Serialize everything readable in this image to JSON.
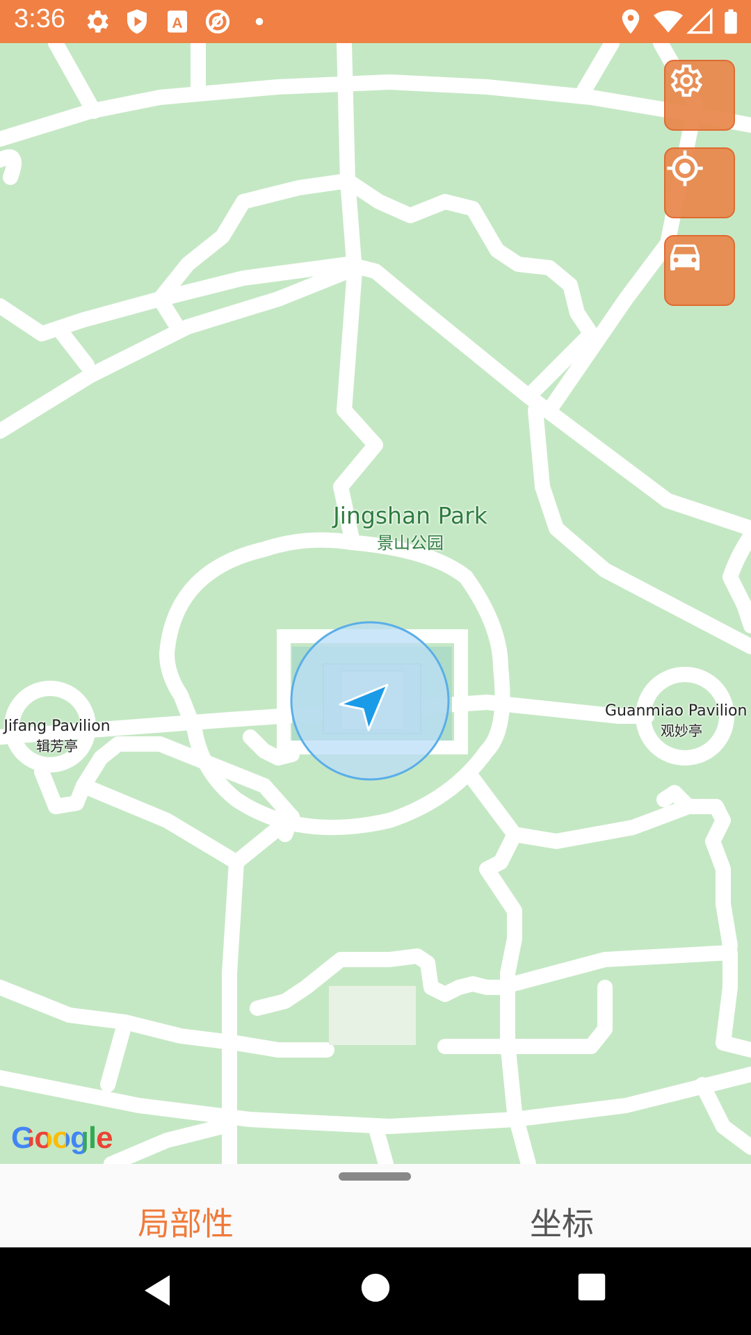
{
  "status_bar": {
    "time": "3:36",
    "left_icons": [
      "settings-icon",
      "shield-icon",
      "font-a-icon",
      "no-sync-icon",
      "dot-icon"
    ],
    "right_icons": [
      "location-pin-icon",
      "wifi-icon",
      "cell-signal-icon",
      "battery-icon"
    ],
    "color": "#F08044"
  },
  "map": {
    "background_color": "#C5E8C4",
    "road_color": "#FFFFFF",
    "labels": {
      "park": {
        "name": "Jingshan Park",
        "name_cn": "景山公园"
      },
      "left_pavilion": {
        "name": "Jifang Pavilion",
        "name_cn": "辑芳亭"
      },
      "right_pavilion": {
        "name": "Guanmiao Pavilion",
        "name_cn": "观妙亭"
      }
    },
    "attribution": "Google",
    "controls": [
      "settings-icon",
      "my-location-icon",
      "car-icon"
    ],
    "accent_color": "#E88A4F",
    "location_marker_color": "#1A9BE8"
  },
  "bottom_sheet": {
    "tabs": [
      {
        "label": "局部性",
        "active": true
      },
      {
        "label": "坐标",
        "active": false
      }
    ],
    "active_color": "#F07A3A",
    "inactive_color": "#555555"
  },
  "nav_bar": {
    "buttons": [
      "back-icon",
      "home-icon",
      "recents-icon"
    ]
  }
}
